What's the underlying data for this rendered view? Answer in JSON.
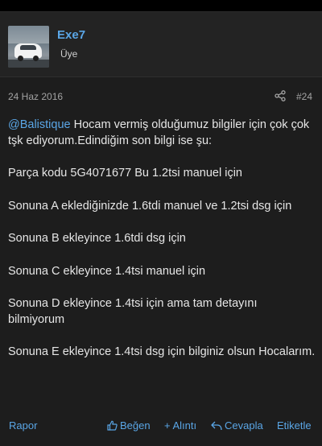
{
  "post": {
    "user": {
      "name": "Exe7",
      "title": "Üye"
    },
    "date": "24 Haz 2016",
    "number": "#24",
    "body": {
      "mention": "@Balistique",
      "line1_rest": " Hocam vermiş olduğumuz bilgiler için çok çok tşk ediyorum.Edindiğim son bilgi ise şu:",
      "paragraphs": [
        "Parça kodu 5G4071677 Bu 1.2tsi manuel için",
        "Sonuna A eklediğinizde 1.6tdi manuel ve 1.2tsi dsg için",
        "Sonuna B ekleyince 1.6tdi dsg için",
        "Sonuna C ekleyince 1.4tsi manuel için",
        "Sonuna D ekleyince 1.4tsi için ama tam detayını bilmiyorum",
        "Sonuna E ekleyince 1.4tsi dsg için bilginiz olsun Hocalarım."
      ]
    }
  },
  "actions": {
    "report": "Rapor",
    "like": "Beğen",
    "quote": "+ Alıntı",
    "reply": "Cevapla",
    "tag": "Etiketle"
  },
  "colors": {
    "link": "#5aa6e6",
    "background": "#1d1d1d",
    "text": "#e6e6e6"
  },
  "icons": {
    "share": "share-icon",
    "like": "thumbs-up-icon",
    "reply": "reply-arrow-icon"
  }
}
